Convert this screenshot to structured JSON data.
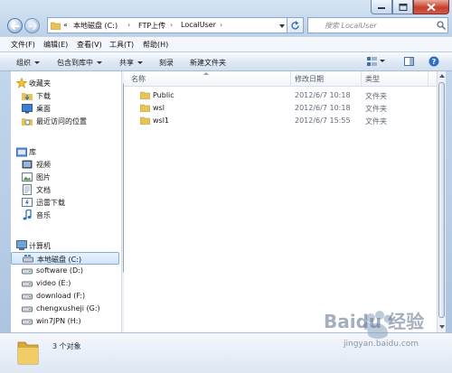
{
  "address": {
    "prefix": "«",
    "segments": [
      "本地磁盘 (C:)",
      "FTP上传",
      "LocalUser"
    ]
  },
  "search": {
    "placeholder": "搜索 LocalUser"
  },
  "menu": [
    "文件(F)",
    "编辑(E)",
    "查看(V)",
    "工具(T)",
    "帮助(H)"
  ],
  "toolbar": {
    "organize": "组织",
    "include_in_library": "包含到库中",
    "share": "共享",
    "burn": "刻录",
    "new_folder": "新建文件夹"
  },
  "nav": {
    "favorites": {
      "label": "收藏夹",
      "items": [
        "下载",
        "桌面",
        "最近访问的位置"
      ]
    },
    "libraries": {
      "label": "库",
      "items": [
        "视频",
        "图片",
        "文档",
        "迅雷下载",
        "音乐"
      ]
    },
    "computer": {
      "label": "计算机",
      "items": [
        "本地磁盘 (C:)",
        "software (D:)",
        "video (E:)",
        "download (F:)",
        "chengxusheji (G:)",
        "win7JPN (H:)"
      ]
    }
  },
  "columns": {
    "name": "名称",
    "date": "修改日期",
    "type": "类型"
  },
  "files": [
    {
      "name": "Public",
      "date": "2012/6/7 10:18",
      "type": "文件夹"
    },
    {
      "name": "wsl",
      "date": "2012/6/7 10:18",
      "type": "文件夹"
    },
    {
      "name": "wsl1",
      "date": "2012/6/7 15:55",
      "type": "文件夹"
    }
  ],
  "status": {
    "count": "3 个对象"
  },
  "watermark": {
    "brand": "Baidu 经验",
    "url": "jingyan.baidu.com"
  },
  "colors": {
    "folder": "#e9c35a",
    "selection": "#cde4fb",
    "accent": "#3a6fb5"
  }
}
